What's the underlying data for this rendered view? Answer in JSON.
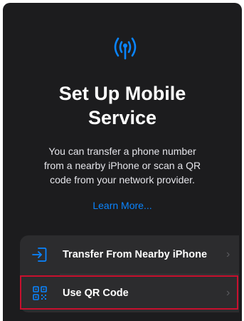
{
  "title": {
    "line1": "Set Up Mobile",
    "line2": "Service"
  },
  "description": {
    "line1": "You can transfer a phone number",
    "line2": "from a nearby iPhone or scan a QR",
    "line3": "code from your network provider."
  },
  "learn_more": "Learn More...",
  "options": [
    {
      "label": "Transfer From Nearby iPhone",
      "icon": "transfer-icon"
    },
    {
      "label": "Use QR Code",
      "icon": "qr-code-icon"
    }
  ],
  "colors": {
    "background": "#1c1c1e",
    "card": "#2c2c2e",
    "accent": "#0a84ff",
    "highlight": "#c8102e"
  }
}
